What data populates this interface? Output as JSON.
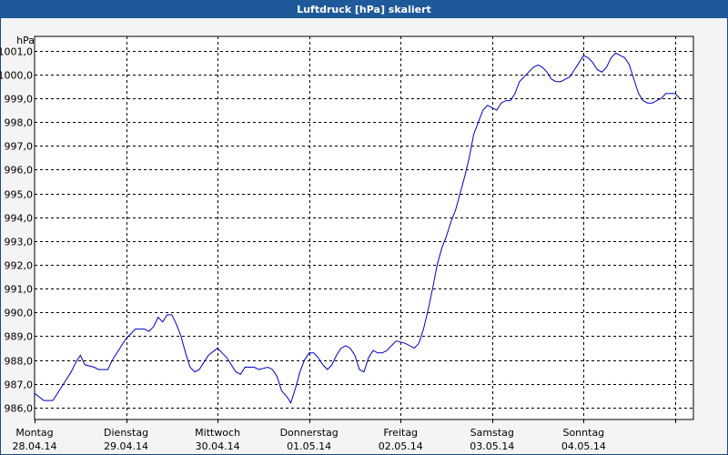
{
  "chart_data": {
    "type": "line",
    "title": "Luftdruck [hPa] skaliert",
    "ylabel": "hPa",
    "ylim": [
      985.5,
      1001.6
    ],
    "xlim": [
      0,
      7.2
    ],
    "yticks": [
      "1001,0",
      "1000,0",
      "999,0",
      "998,0",
      "997,0",
      "996,0",
      "995,0",
      "994,0",
      "993,0",
      "992,0",
      "991,0",
      "990,0",
      "989,0",
      "988,0",
      "987,0",
      "986,0"
    ],
    "ytick_values": [
      1001,
      1000,
      999,
      998,
      997,
      996,
      995,
      994,
      993,
      992,
      991,
      990,
      989,
      988,
      987,
      986
    ],
    "xticks": [
      {
        "day": "Montag",
        "date": "28.04.14"
      },
      {
        "day": "Dienstag",
        "date": "29.04.14"
      },
      {
        "day": "Mittwoch",
        "date": "30.04.14"
      },
      {
        "day": "Donnerstag",
        "date": "01.05.14"
      },
      {
        "day": "Freitag",
        "date": "02.05.14"
      },
      {
        "day": "Samstag",
        "date": "03.05.14"
      },
      {
        "day": "Sonntag",
        "date": "04.05.14"
      }
    ],
    "grid": true,
    "line_color": "#0000c8",
    "series": [
      {
        "values": [
          [
            0.0,
            986.6
          ],
          [
            0.1,
            986.3
          ],
          [
            0.2,
            986.3
          ],
          [
            0.3,
            986.9
          ],
          [
            0.4,
            987.5
          ],
          [
            0.45,
            987.9
          ],
          [
            0.5,
            988.2
          ],
          [
            0.55,
            987.8
          ],
          [
            0.65,
            987.7
          ],
          [
            0.7,
            987.6
          ],
          [
            0.8,
            987.6
          ],
          [
            0.85,
            988.0
          ],
          [
            0.95,
            988.6
          ],
          [
            1.0,
            988.9
          ],
          [
            1.1,
            989.3
          ],
          [
            1.2,
            989.3
          ],
          [
            1.25,
            989.2
          ],
          [
            1.3,
            989.4
          ],
          [
            1.35,
            989.8
          ],
          [
            1.4,
            989.6
          ],
          [
            1.45,
            989.9
          ],
          [
            1.5,
            989.9
          ],
          [
            1.55,
            989.5
          ],
          [
            1.6,
            989.0
          ],
          [
            1.65,
            988.3
          ],
          [
            1.7,
            987.7
          ],
          [
            1.75,
            987.5
          ],
          [
            1.8,
            987.6
          ],
          [
            1.85,
            987.9
          ],
          [
            1.9,
            988.2
          ],
          [
            2.0,
            988.5
          ],
          [
            2.05,
            988.3
          ],
          [
            2.1,
            988.1
          ],
          [
            2.15,
            987.8
          ],
          [
            2.2,
            987.5
          ],
          [
            2.25,
            987.4
          ],
          [
            2.3,
            987.7
          ],
          [
            2.4,
            987.7
          ],
          [
            2.45,
            987.6
          ],
          [
            2.55,
            987.7
          ],
          [
            2.6,
            987.6
          ],
          [
            2.65,
            987.3
          ],
          [
            2.7,
            986.7
          ],
          [
            2.75,
            986.5
          ],
          [
            2.8,
            986.2
          ],
          [
            2.85,
            986.8
          ],
          [
            2.9,
            987.5
          ],
          [
            2.95,
            988.0
          ],
          [
            3.0,
            988.3
          ],
          [
            3.05,
            988.3
          ],
          [
            3.1,
            988.1
          ],
          [
            3.15,
            987.8
          ],
          [
            3.2,
            987.6
          ],
          [
            3.25,
            987.8
          ],
          [
            3.3,
            988.2
          ],
          [
            3.35,
            988.5
          ],
          [
            3.4,
            988.6
          ],
          [
            3.45,
            988.5
          ],
          [
            3.5,
            988.2
          ],
          [
            3.55,
            987.6
          ],
          [
            3.6,
            987.5
          ],
          [
            3.65,
            988.1
          ],
          [
            3.7,
            988.4
          ],
          [
            3.75,
            988.3
          ],
          [
            3.8,
            988.3
          ],
          [
            3.85,
            988.4
          ],
          [
            3.9,
            988.6
          ],
          [
            3.95,
            988.8
          ],
          [
            4.05,
            988.7
          ],
          [
            4.1,
            988.6
          ],
          [
            4.15,
            988.5
          ],
          [
            4.2,
            988.7
          ],
          [
            4.25,
            989.3
          ],
          [
            4.3,
            990.1
          ],
          [
            4.35,
            991.0
          ],
          [
            4.4,
            992.0
          ],
          [
            4.45,
            992.7
          ],
          [
            4.5,
            993.2
          ],
          [
            4.55,
            993.8
          ],
          [
            4.6,
            994.3
          ],
          [
            4.65,
            995.0
          ],
          [
            4.7,
            995.7
          ],
          [
            4.75,
            996.5
          ],
          [
            4.8,
            997.5
          ],
          [
            4.85,
            998.0
          ],
          [
            4.9,
            998.5
          ],
          [
            4.95,
            998.7
          ],
          [
            5.0,
            998.6
          ],
          [
            5.05,
            998.5
          ],
          [
            5.1,
            998.8
          ],
          [
            5.15,
            998.9
          ],
          [
            5.2,
            998.9
          ],
          [
            5.25,
            999.2
          ],
          [
            5.3,
            999.7
          ],
          [
            5.4,
            1000.1
          ],
          [
            5.45,
            1000.3
          ],
          [
            5.5,
            1000.4
          ],
          [
            5.55,
            1000.3
          ],
          [
            5.6,
            1000.1
          ],
          [
            5.65,
            999.8
          ],
          [
            5.7,
            999.7
          ],
          [
            5.75,
            999.7
          ],
          [
            5.8,
            999.8
          ],
          [
            5.85,
            999.9
          ],
          [
            5.9,
            1000.2
          ],
          [
            5.95,
            1000.5
          ],
          [
            6.0,
            1000.8
          ],
          [
            6.05,
            1000.7
          ],
          [
            6.1,
            1000.5
          ],
          [
            6.15,
            1000.2
          ],
          [
            6.2,
            1000.1
          ],
          [
            6.25,
            1000.3
          ],
          [
            6.3,
            1000.7
          ],
          [
            6.35,
            1000.9
          ],
          [
            6.4,
            1000.8
          ],
          [
            6.45,
            1000.7
          ],
          [
            6.5,
            1000.4
          ],
          [
            6.55,
            999.8
          ],
          [
            6.6,
            999.2
          ],
          [
            6.65,
            998.9
          ],
          [
            6.7,
            998.8
          ],
          [
            6.75,
            998.8
          ],
          [
            6.8,
            998.9
          ],
          [
            6.85,
            999.0
          ],
          [
            6.9,
            999.2
          ],
          [
            6.95,
            999.2
          ],
          [
            7.0,
            999.2
          ],
          [
            7.05,
            999.0
          ]
        ]
      }
    ]
  }
}
